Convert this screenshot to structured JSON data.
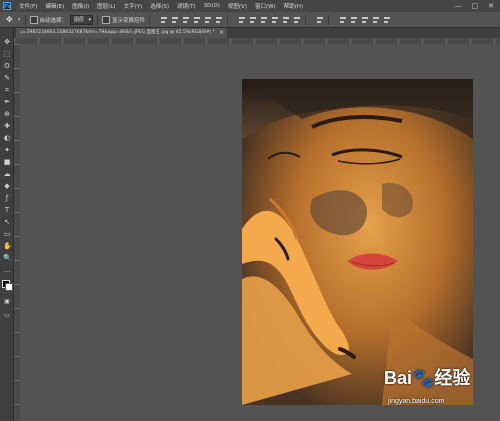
{
  "app": {
    "logo_text": "Ps"
  },
  "menu": [
    "文件(F)",
    "编辑(E)",
    "图像(I)",
    "图层(L)",
    "文字(Y)",
    "选择(S)",
    "滤镜(T)",
    "3D(D)",
    "视图(V)",
    "窗口(W)",
    "帮助(H)"
  ],
  "window_controls": [
    "—",
    "□",
    "✕"
  ],
  "options_bar": {
    "auto_select_label": "自动选择：",
    "auto_select_value": "图层",
    "show_transform_label": "显示变换控件"
  },
  "document_tab": {
    "title": "u=2987234663,1586327687&fm=79&app=86&f=JPEG.显图王.jpg @ 45.5%(RGB/8#) *",
    "close_glyph": "×"
  },
  "tools": [
    "✥",
    "⬚",
    "ʘ",
    "✎",
    "⌗",
    "✒",
    "⊕",
    "✚",
    "◐",
    "✦",
    "■",
    "☁",
    "◆",
    "ƒ",
    "T",
    "↖",
    "▭",
    "✋",
    "🔍",
    "…"
  ],
  "watermark": {
    "logo_text": "Bai🐾经验",
    "url": "jingyan.baidu.com"
  }
}
